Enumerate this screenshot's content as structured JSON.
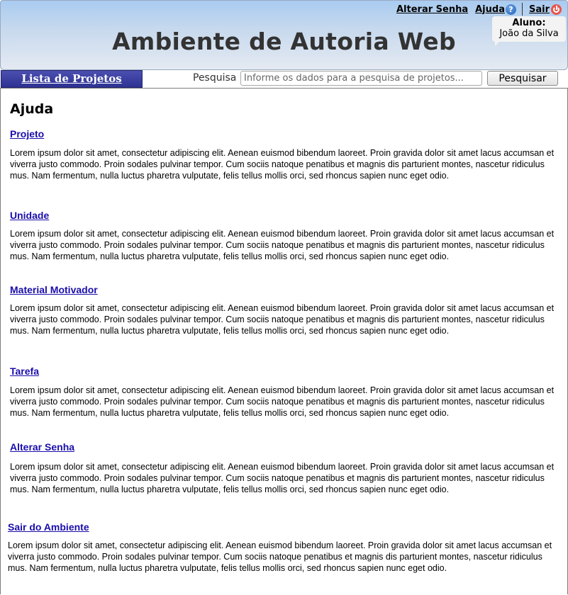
{
  "header": {
    "title": "Ambiente de Autoria Web",
    "links": {
      "change_password": "Alterar Senha",
      "help": "Ajuda",
      "help_icon": "question-circle-icon",
      "logout": "Sair",
      "logout_icon": "power-icon"
    },
    "user": {
      "role": "Aluno:",
      "name": "João da Silva"
    }
  },
  "toolbar": {
    "projects_button": "Lista de Projetos",
    "search_label": "Pesquisa",
    "search_placeholder": "Informe os dados para a pesquisa de projetos...",
    "search_button": "Pesquisar"
  },
  "main": {
    "heading": "Ajuda",
    "sections": [
      {
        "title": "Projeto",
        "text": "Lorem ipsum dolor sit amet, consectetur adipiscing elit. Aenean euismod bibendum laoreet. Proin gravida dolor sit amet lacus accumsan et viverra justo commodo. Proin sodales pulvinar tempor. Cum sociis natoque penatibus et magnis dis parturient montes, nascetur ridiculus mus. Nam fermentum, nulla luctus pharetra vulputate, felis tellus mollis orci, sed rhoncus sapien nunc eget odio."
      },
      {
        "title": "Unidade",
        "text": "Lorem ipsum dolor sit amet, consectetur adipiscing elit. Aenean euismod bibendum laoreet. Proin gravida dolor sit amet lacus accumsan et viverra justo commodo. Proin sodales pulvinar tempor. Cum sociis natoque penatibus et magnis dis parturient montes, nascetur ridiculus mus. Nam fermentum, nulla luctus pharetra vulputate, felis tellus mollis orci, sed rhoncus sapien nunc eget odio."
      },
      {
        "title": "Material Motivador",
        "text": "Lorem ipsum dolor sit amet, consectetur adipiscing elit. Aenean euismod bibendum laoreet. Proin gravida dolor sit amet lacus accumsan et viverra justo commodo. Proin sodales pulvinar tempor. Cum sociis natoque penatibus et magnis dis parturient montes, nascetur ridiculus mus. Nam fermentum, nulla luctus pharetra vulputate, felis tellus mollis orci, sed rhoncus sapien nunc eget odio."
      },
      {
        "title": "Tarefa",
        "text": "Lorem ipsum dolor sit amet, consectetur adipiscing elit. Aenean euismod bibendum laoreet. Proin gravida dolor sit amet lacus accumsan et viverra justo commodo. Proin sodales pulvinar tempor. Cum sociis natoque penatibus et magnis dis parturient montes, nascetur ridiculus mus. Nam fermentum, nulla luctus pharetra vulputate, felis tellus mollis orci, sed rhoncus sapien nunc eget odio."
      },
      {
        "title": "Alterar Senha",
        "text": "Lorem ipsum dolor sit amet, consectetur adipiscing elit. Aenean euismod bibendum laoreet. Proin gravida dolor sit amet lacus accumsan et viverra justo commodo. Proin sodales pulvinar tempor. Cum sociis natoque penatibus et magnis dis parturient montes, nascetur ridiculus mus. Nam fermentum, nulla luctus pharetra vulputate, felis tellus mollis orci, sed rhoncus sapien nunc eget odio."
      },
      {
        "title": "Sair do Ambiente",
        "text": "Lorem ipsum dolor sit amet, consectetur adipiscing elit. Aenean euismod bibendum laoreet. Proin gravida dolor sit amet lacus accumsan et viverra justo commodo. Proin sodales pulvinar tempor. Cum sociis natoque penatibus et magnis dis parturient montes, nascetur ridiculus mus. Nam fermentum, nulla luctus pharetra vulputate, felis tellus mollis orci, sed rhoncus sapien nunc eget odio."
      }
    ]
  }
}
